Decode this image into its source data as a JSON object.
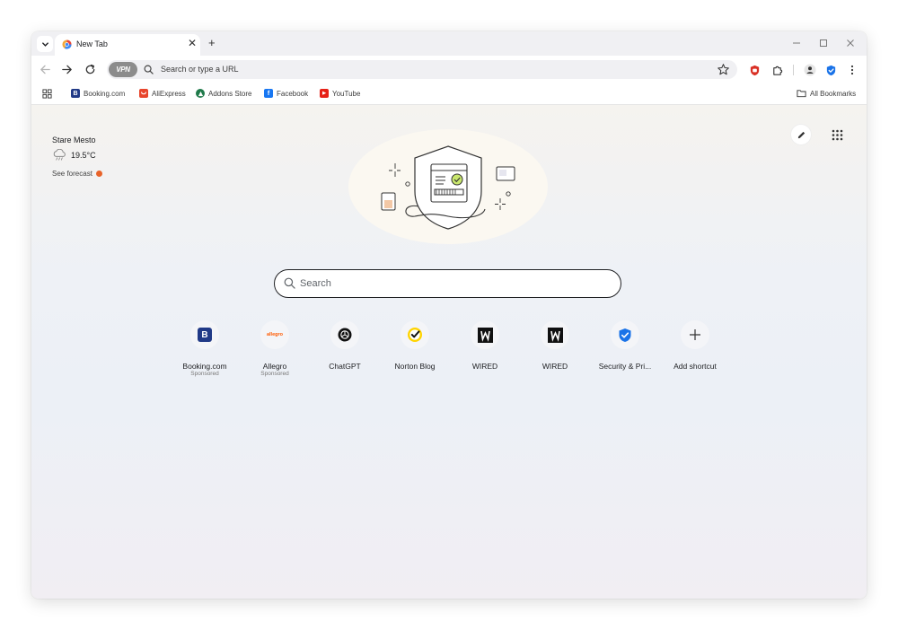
{
  "tab": {
    "title": "New Tab",
    "close_glyph": "✕"
  },
  "new_tab_glyph": "+",
  "window_controls": {
    "minimize": "—",
    "maximize": "☐",
    "close": "✕"
  },
  "toolbar": {
    "vpn_label": "VPN",
    "omnibox_placeholder": "Search or type a URL"
  },
  "bookmarks": {
    "items": [
      {
        "label": "Booking.com",
        "icon": "booking-icon",
        "color": "#213a87",
        "glyph": "B"
      },
      {
        "label": "AliExpress",
        "icon": "aliexpress-icon",
        "color": "#e8452c",
        "glyph": ""
      },
      {
        "label": "Addons Store",
        "icon": "addons-store-icon",
        "color": "#1f7a4a",
        "glyph": ""
      },
      {
        "label": "Facebook",
        "icon": "facebook-icon",
        "color": "#1877f2",
        "glyph": "f"
      },
      {
        "label": "YouTube",
        "icon": "youtube-icon",
        "color": "#e62117",
        "glyph": "▶"
      }
    ],
    "all_bookmarks": "All Bookmarks"
  },
  "weather": {
    "city": "Stare Mesto",
    "temperature": "19.5°C",
    "forecast_link": "See forecast",
    "icon": "rain-cloud-icon"
  },
  "search": {
    "placeholder": "Search"
  },
  "shortcuts": [
    {
      "label": "Booking.com",
      "sub": "Sponsored",
      "icon": "booking-icon"
    },
    {
      "label": "Allegro",
      "sub": "Sponsored",
      "icon": "allegro-icon",
      "logo_text": "allegro"
    },
    {
      "label": "ChatGPT",
      "sub": "",
      "icon": "chatgpt-icon"
    },
    {
      "label": "Norton Blog",
      "sub": "",
      "icon": "norton-icon"
    },
    {
      "label": "WIRED",
      "sub": "",
      "icon": "wired-icon"
    },
    {
      "label": "WIRED",
      "sub": "",
      "icon": "wired-icon"
    },
    {
      "label": "Security & Pri...",
      "sub": "",
      "icon": "shield-icon"
    },
    {
      "label": "Add shortcut",
      "sub": "",
      "icon": "plus-icon"
    }
  ],
  "colors": {
    "accent_blue": "#1a73e8",
    "norton_yellow": "#ffd400",
    "content_bg": "#eef1f6"
  }
}
